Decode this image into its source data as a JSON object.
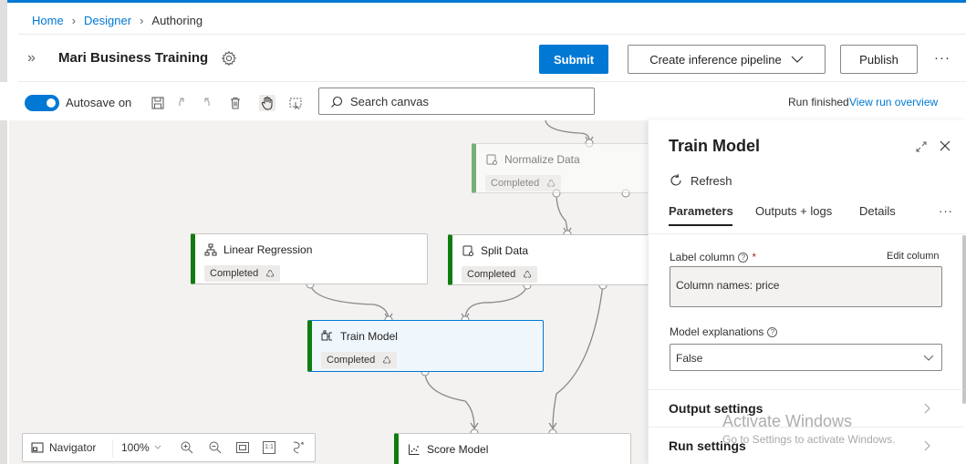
{
  "breadcrumb": {
    "home": "Home",
    "designer": "Designer",
    "current": "Authoring"
  },
  "header": {
    "title": "Mari Business Training",
    "submit_label": "Submit",
    "create_inference_label": "Create inference pipeline",
    "publish_label": "Publish",
    "more_label": "···"
  },
  "toolbar": {
    "autosave_label": "Autosave on",
    "autosave_on": true,
    "search_placeholder": "Search canvas",
    "run_status": "Run finished",
    "run_link": "View run overview"
  },
  "canvas": {
    "nodes": [
      {
        "title": "Normalize Data",
        "status": "Completed"
      },
      {
        "title": "Linear Regression",
        "status": "Completed"
      },
      {
        "title": "Split Data",
        "status": "Completed"
      },
      {
        "title": "Train Model",
        "status": "Completed"
      },
      {
        "title": "Score Model"
      }
    ],
    "navigator": {
      "label": "Navigator",
      "zoom": "100%",
      "fit_label": "1:1"
    }
  },
  "panel": {
    "title": "Train Model",
    "refresh_label": "Refresh",
    "tabs": [
      {
        "label": "Parameters",
        "active": true
      },
      {
        "label": "Outputs + logs"
      },
      {
        "label": "Details"
      }
    ],
    "tabs_more": "···",
    "label_column": {
      "label": "Label column",
      "required_mark": "*",
      "edit_label": "Edit column",
      "value": "Column names: price"
    },
    "model_explanations": {
      "label": "Model explanations",
      "value": "False"
    },
    "sections": [
      {
        "label": "Output settings"
      },
      {
        "label": "Run settings"
      }
    ]
  },
  "watermark": {
    "line1": "Activate Windows",
    "line2": "Go to Settings to activate Windows."
  },
  "colors": {
    "accent": "#0078d4",
    "completed": "#107c10",
    "canvas": "#f3f2f1"
  }
}
